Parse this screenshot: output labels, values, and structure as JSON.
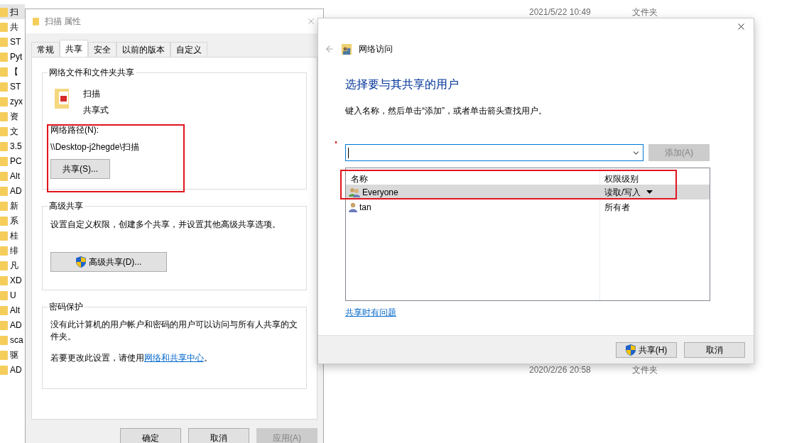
{
  "explorer": {
    "rows": [
      {
        "name": "扫",
        "date": "2021/5/22 10:49",
        "type": "文件夹",
        "selected": true
      },
      {
        "name": "共",
        "selected": false
      },
      {
        "name": "ST",
        "selected": false
      },
      {
        "name": "Pyt",
        "selected": false
      },
      {
        "name": "【",
        "selected": false
      },
      {
        "name": "ST",
        "selected": false
      },
      {
        "name": "zyx",
        "selected": false
      },
      {
        "name": "资",
        "selected": false
      },
      {
        "name": "文",
        "selected": false
      },
      {
        "name": "3.5",
        "selected": false
      },
      {
        "name": "PC",
        "selected": false
      },
      {
        "name": "Alt",
        "selected": false
      },
      {
        "name": "AD",
        "selected": false
      },
      {
        "name": "新",
        "selected": false
      },
      {
        "name": "系",
        "selected": false
      },
      {
        "name": "桂",
        "selected": false
      },
      {
        "name": "绯",
        "selected": false
      },
      {
        "name": "凡",
        "selected": false
      },
      {
        "name": "XD",
        "selected": false
      },
      {
        "name": "U",
        "selected": false
      },
      {
        "name": "Alt",
        "selected": false
      },
      {
        "name": "AD",
        "selected": false
      },
      {
        "name": "sca",
        "selected": false
      },
      {
        "name": "驱",
        "selected": false
      },
      {
        "name": "AD",
        "date": "2020/2/26 20:58",
        "type": "文件夹",
        "selected": false
      }
    ]
  },
  "properties": {
    "title": "扫描 属性",
    "tabs": [
      {
        "label": "常规",
        "selected": false
      },
      {
        "label": "共享",
        "selected": true
      },
      {
        "label": "安全",
        "selected": false
      },
      {
        "label": "以前的版本",
        "selected": false
      },
      {
        "label": "自定义",
        "selected": false
      }
    ],
    "network_sharing": {
      "heading": "网络文件和文件夹共享",
      "folder_name": "扫描",
      "folder_status": "共享式",
      "path_label": "网络路径(N):",
      "path": "\\\\Desktop-j2hegde\\扫描",
      "share_button": "共享(S)..."
    },
    "advanced_sharing": {
      "heading": "高级共享",
      "description": "设置自定义权限，创建多个共享，并设置其他高级共享选项。",
      "button": "高级共享(D)..."
    },
    "password_protection": {
      "heading": "密码保护",
      "description": "没有此计算机的用户帐户和密码的用户可以访问与所有人共享的文件夹。",
      "note_prefix": "若要更改此设置，请使用",
      "link": "网络和共享中心",
      "note_suffix": "。"
    },
    "buttons": [
      {
        "label": "确定",
        "disabled": false
      },
      {
        "label": "取消",
        "disabled": false
      },
      {
        "label": "应用(A)",
        "disabled": true
      }
    ]
  },
  "network_access": {
    "title": "网络访问",
    "heading": "选择要与其共享的用户",
    "instruction": "键入名称，然后单击“添加”，或者单击箭头查找用户。",
    "add_button": {
      "label": "添加(A)",
      "disabled": true
    },
    "columns": [
      "名称",
      "权限级别"
    ],
    "users": [
      {
        "kind": "group",
        "name": "Everyone",
        "permission": "读取/写入",
        "menu": true,
        "selected": true
      },
      {
        "kind": "user",
        "name": "tan",
        "permission": "所有者",
        "menu": false,
        "selected": false
      }
    ],
    "help_link": "共享时有问题",
    "buttons": [
      {
        "label": "共享(H)",
        "shield": true
      },
      {
        "label": "取消",
        "shield": false
      }
    ]
  }
}
